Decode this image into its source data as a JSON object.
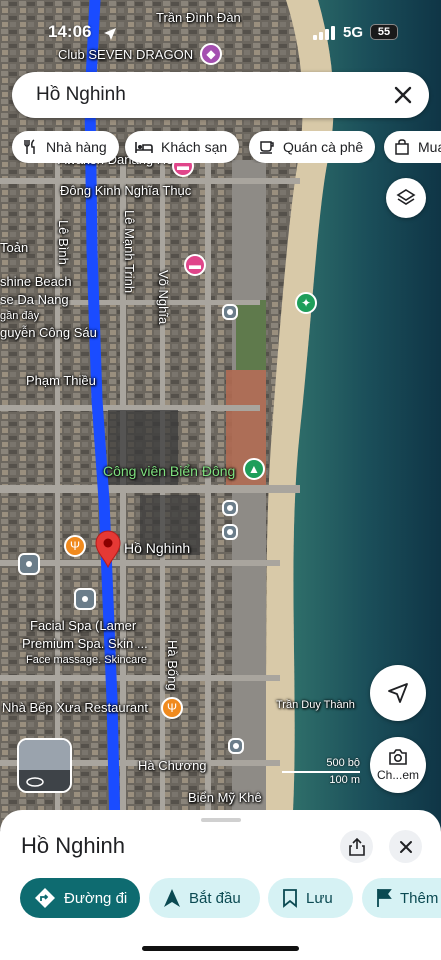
{
  "status": {
    "time": "14:06",
    "network": "5G",
    "battery": "55"
  },
  "search": {
    "query": "Hồ Nghinh"
  },
  "chips": [
    {
      "label": "Nhà hàng",
      "icon": "fork-knife-icon"
    },
    {
      "label": "Khách sạn",
      "icon": "bed-icon"
    },
    {
      "label": "Quán cà phê",
      "icon": "coffee-cup-icon"
    },
    {
      "label": "Mua",
      "icon": "shopping-bag-icon"
    }
  ],
  "map": {
    "labels": {
      "seven_dragon": "Club SEVEN DRAGON",
      "tran_dinh_dan": "Trần Đình Đàn",
      "awaken": "Awaken Danang Hotel",
      "dong_kinh": "Đông Kinh Nghĩa Thục",
      "le_binh": "Lê Bình",
      "le_manh_trinh": "Lê Mạnh Trinh",
      "vo_nghia": "Võ Nghĩa",
      "toan": "Toản",
      "shine_beach": "shine Beach",
      "se_da_nang": "se Da Nang",
      "gan_day": "gần đây",
      "nguyen_cong_sau": "guyễn Công Sáu",
      "pham_thieu": "Phạm Thiều",
      "cong_vien": "Công viên Biển Đông",
      "ho_nghinh_pin": "Hồ Nghinh",
      "facial_spa_1": "Facial Spa (Lamer",
      "facial_spa_2": "Premium Spa. Skin ...",
      "facial_spa_3": "Face massage. Skincare",
      "ha_bong": "Hà Bổng",
      "nha_bep": "Nhà Bếp Xưa Restaurant",
      "ha_chuong": "Hà Chương",
      "bien_my_khe": "Biển Mỹ Khê",
      "tran_duy_thanh": "Trần Duy Thành"
    },
    "scale": {
      "imperial": "500 bộ",
      "metric": "100 m"
    },
    "lens_label": "Ch...em",
    "route_color": "#1a4cff",
    "pin_color": "#e53935"
  },
  "sheet": {
    "title": "Hồ Nghinh",
    "actions": {
      "directions": "Đường đi",
      "start": "Bắt đầu",
      "save": "Lưu",
      "more": "Thêm"
    }
  }
}
